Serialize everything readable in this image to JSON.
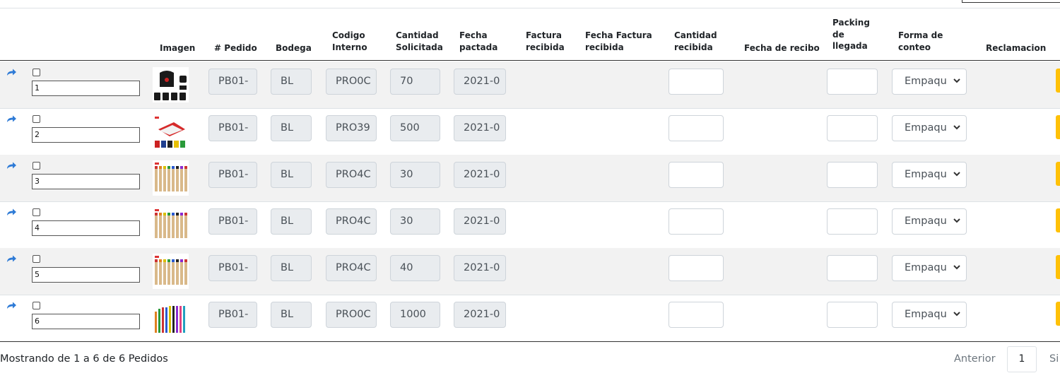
{
  "table": {
    "headers": {
      "imagen": "Imagen",
      "pedido": "# Pedido",
      "bodega": "Bodega",
      "codigo_interno": [
        "Codigo",
        "Interno"
      ],
      "cantidad_solicitada": [
        "Cantidad",
        "Solicitada"
      ],
      "fecha_pactada": [
        "Fecha",
        "pactada"
      ],
      "factura_recibida": [
        "Factura",
        "recibida"
      ],
      "fecha_factura_recibida": [
        "Fecha Factura",
        "recibida"
      ],
      "cantidad_recibida": [
        "Cantidad",
        "recibida"
      ],
      "fecha_de_recibo": "Fecha de recibo",
      "packing_de_llegada": [
        "Packing",
        "de",
        "llegada"
      ],
      "forma_de_conteo": [
        "Forma de",
        "conteo"
      ],
      "reclamacion": "Reclamacion"
    },
    "rows": [
      {
        "num": "1",
        "pedido": "PB01-",
        "bodega": "BL",
        "codigo": "PRO0C",
        "cantidad": "70",
        "fecha": "2021-0",
        "forma": "Empaqu",
        "image": "backpack-product-icon"
      },
      {
        "num": "2",
        "pedido": "PB01-",
        "bodega": "BL",
        "codigo": "PRO39",
        "cantidad": "500",
        "fecha": "2021-0",
        "forma": "Empaqu",
        "image": "notebook-product-icon"
      },
      {
        "num": "3",
        "pedido": "PB01-",
        "bodega": "BL",
        "codigo": "PRO4C",
        "cantidad": "30",
        "fecha": "2021-0",
        "forma": "Empaqu",
        "image": "pens-product-icon"
      },
      {
        "num": "4",
        "pedido": "PB01-",
        "bodega": "BL",
        "codigo": "PRO4C",
        "cantidad": "30",
        "fecha": "2021-0",
        "forma": "Empaqu",
        "image": "pens-product-icon"
      },
      {
        "num": "5",
        "pedido": "PB01-",
        "bodega": "BL",
        "codigo": "PRO4C",
        "cantidad": "40",
        "fecha": "2021-0",
        "forma": "Empaqu",
        "image": "pens-product-icon"
      },
      {
        "num": "6",
        "pedido": "PB01-",
        "bodega": "BL",
        "codigo": "PRO0C",
        "cantidad": "1000",
        "fecha": "2021-0",
        "forma": "Empaqu",
        "image": "pens-product-icon"
      }
    ]
  },
  "footer": {
    "info": "Mostrando de 1 a 6 de 6 Pedidos",
    "prev_label": "Anterior",
    "page_label": "1",
    "next_label": "Si"
  },
  "colors": {
    "share_icon": "#2f7bd6",
    "action_button": "#ffc107",
    "readonly_bg": "#e9ecef",
    "row_stripe": "#f2f2f2"
  }
}
